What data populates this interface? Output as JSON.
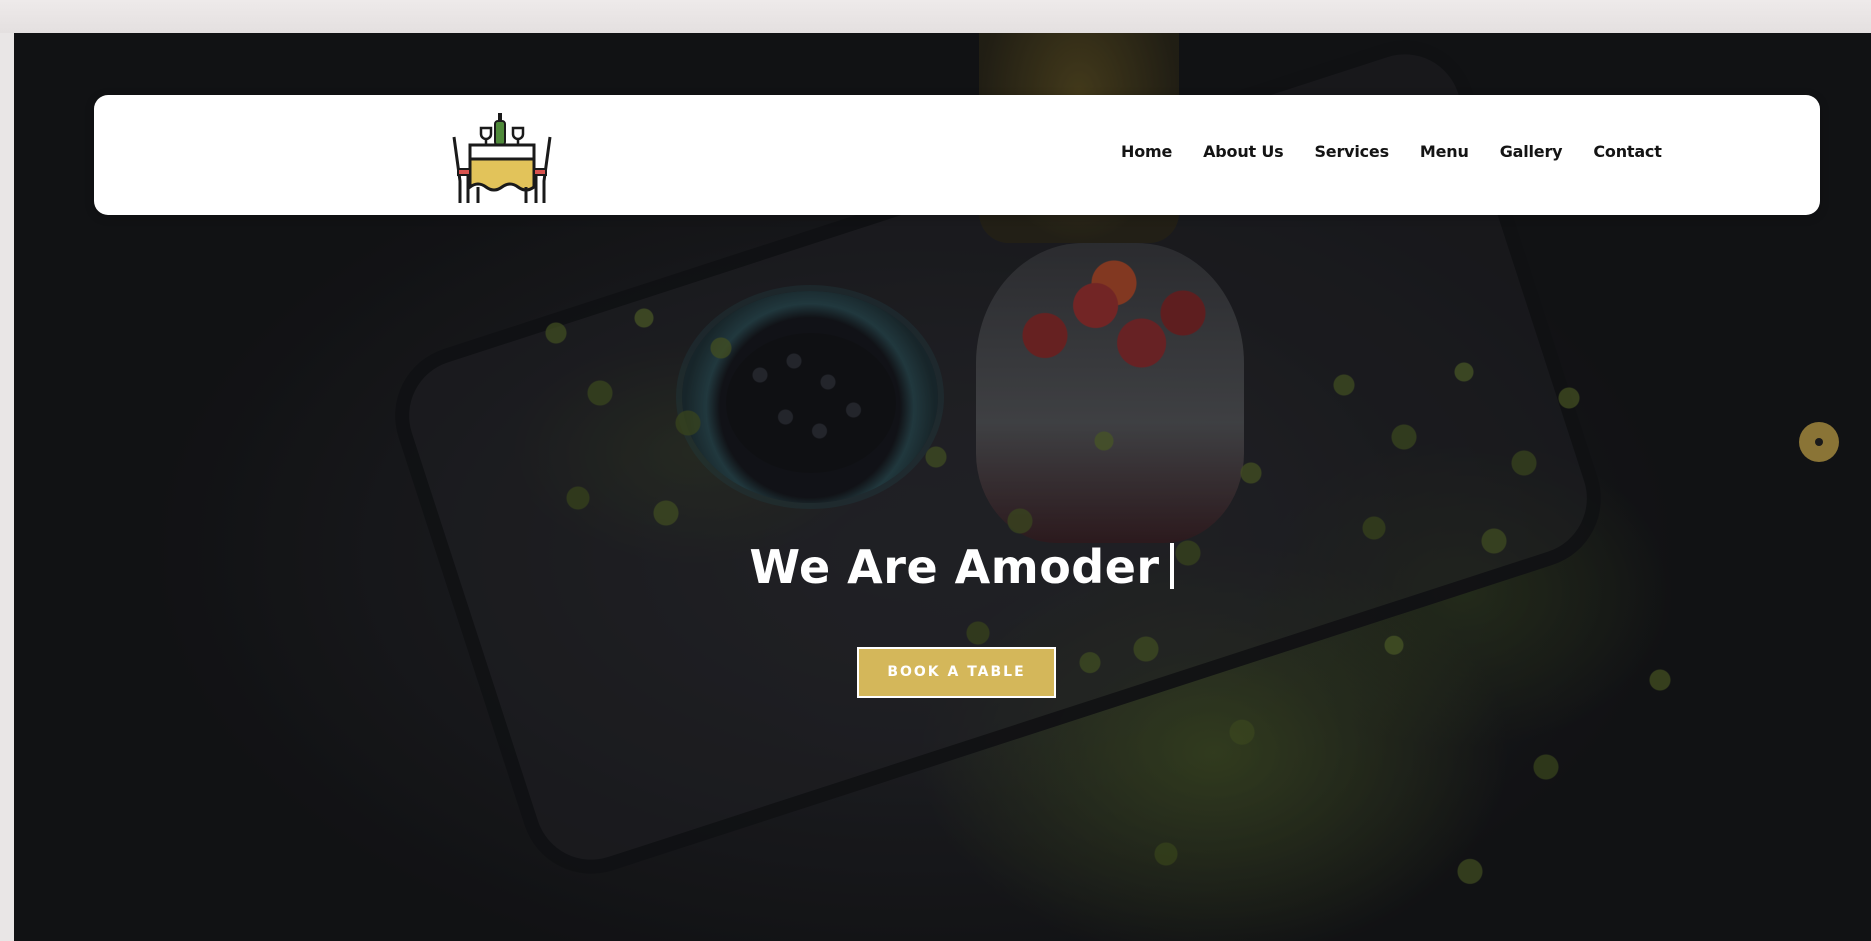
{
  "header": {
    "logo_name": "restaurant-table-logo",
    "nav": [
      {
        "label": "Home"
      },
      {
        "label": "About Us"
      },
      {
        "label": "Services"
      },
      {
        "label": "Menu"
      },
      {
        "label": "Gallery"
      },
      {
        "label": "Contact"
      }
    ]
  },
  "hero": {
    "title": "We Are Amoder",
    "button_label": "BOOK A TABLE",
    "floating_button_icon": "dot-icon"
  },
  "colors": {
    "accent": "#d4b75a",
    "header_bg": "#ffffff",
    "nav_text": "#141414",
    "hero_text": "#ffffff",
    "floating_button": "#8a7436"
  }
}
